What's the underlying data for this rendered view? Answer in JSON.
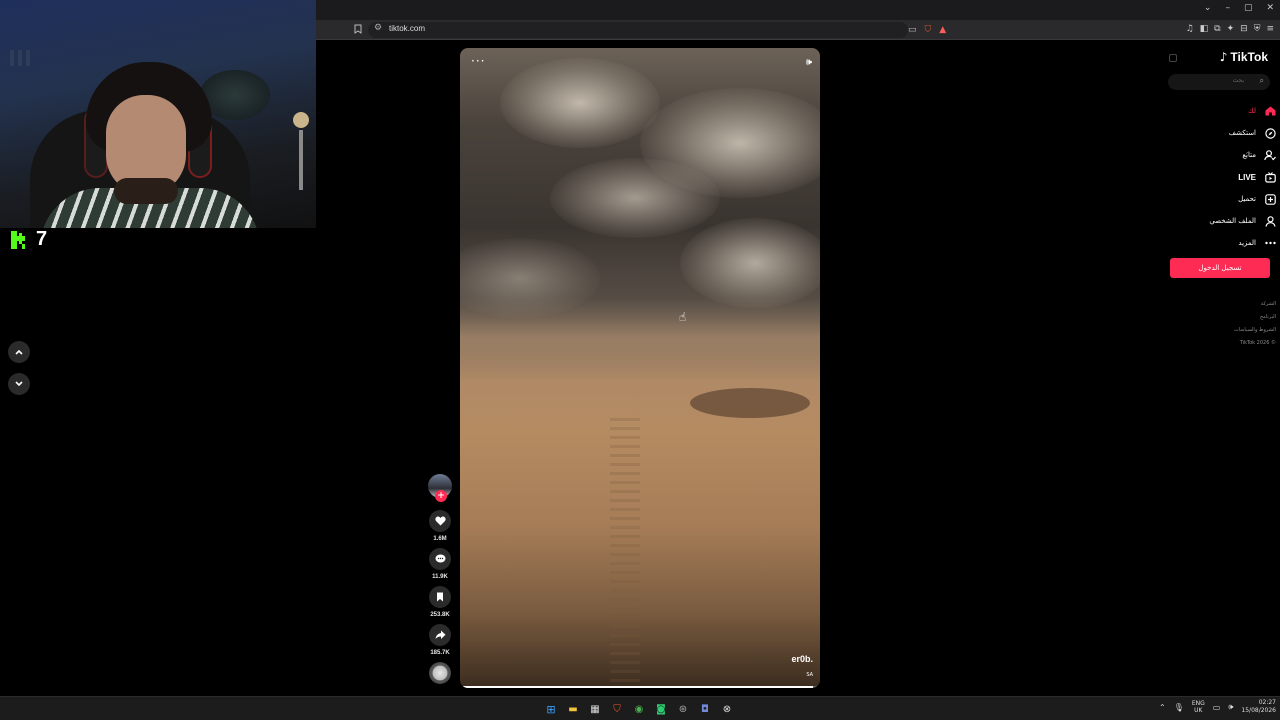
{
  "browser": {
    "url": "tiktok.com",
    "window_controls": [
      "⌄",
      "–",
      "▢",
      "✕"
    ]
  },
  "stream": {
    "viewer_count": "7",
    "wall_labels": [
      "",
      "",
      ""
    ]
  },
  "video": {
    "watermark": "er0b.",
    "tag": "SA",
    "progress": 0.98
  },
  "actions": {
    "likes": "1.6M",
    "comments": "11.9K",
    "saves": "253.8K",
    "shares": "185.7K",
    "follow_symbol": "+"
  },
  "sidebar": {
    "logo_text": "TikTok",
    "search_placeholder": "بحث",
    "menu": [
      {
        "label": "لك",
        "icon": "home-icon",
        "active": true
      },
      {
        "label": "استكشف",
        "icon": "compass-icon",
        "active": false
      },
      {
        "label": "متابَع",
        "icon": "following-icon",
        "active": false
      },
      {
        "label": "LIVE",
        "icon": "live-icon",
        "active": false
      },
      {
        "label": "تحميل",
        "icon": "upload-icon",
        "active": false
      },
      {
        "label": "الملف الشخصي",
        "icon": "profile-icon",
        "active": false
      },
      {
        "label": "المزيد",
        "icon": "more-icon",
        "active": false
      }
    ],
    "login_label": "تسجيل الدخول",
    "footer": [
      "الشركة",
      "البرنامج",
      "الشروط والسياسات",
      "© 2026 TikTok"
    ]
  },
  "taskbar": {
    "lang_top": "ENG",
    "lang_bottom": "UK",
    "time": "02:27",
    "date": "15/08/2026"
  },
  "colors": {
    "accent": "#fe2c55",
    "kick_green": "#53fc18",
    "background": "#000000"
  }
}
